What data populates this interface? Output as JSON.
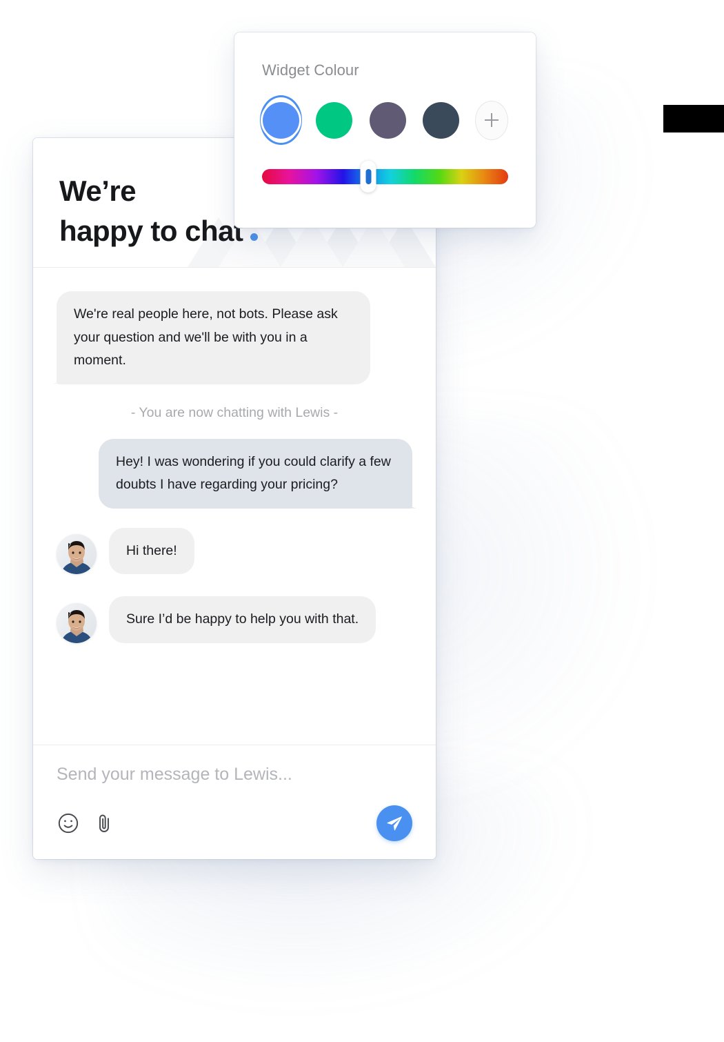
{
  "colour_panel": {
    "label": "Widget Colour",
    "swatches": [
      {
        "name": "blue",
        "hex": "#5490f5",
        "selected": true
      },
      {
        "name": "green",
        "hex": "#00c781",
        "selected": false
      },
      {
        "name": "purple-grey",
        "hex": "#615a75",
        "selected": false
      },
      {
        "name": "slate",
        "hex": "#3b4a5a",
        "selected": false
      }
    ],
    "add_swatch_label": "+",
    "hue_slider": {
      "value_percent": 43,
      "thumb_colour": "#1f6fd0"
    }
  },
  "chat_widget": {
    "header": {
      "title_line1": "We’re",
      "title_line2": "happy to chat",
      "accent_colour": "#4a90e8"
    },
    "messages": [
      {
        "type": "agent",
        "text": "We're real people here, not bots. Please ask your question and we'll be with you in a moment."
      },
      {
        "type": "system",
        "text": "- You are now chatting with Lewis -"
      },
      {
        "type": "visitor",
        "text": "Hey! I was wondering if you could clarify a few doubts I have regarding your pricing?"
      },
      {
        "type": "agent_avatar",
        "text": "Hi there!",
        "avatar_name": "lewis-avatar"
      },
      {
        "type": "agent_avatar",
        "text": "Sure I’d be happy to help you with that.",
        "avatar_name": "lewis-avatar"
      }
    ],
    "composer": {
      "placeholder": "Send your message to Lewis...",
      "value": "",
      "emoji_icon": "smiley-icon",
      "attach_icon": "paperclip-icon",
      "send_icon": "paper-plane-icon",
      "send_button_colour": "#4a90f0"
    }
  }
}
